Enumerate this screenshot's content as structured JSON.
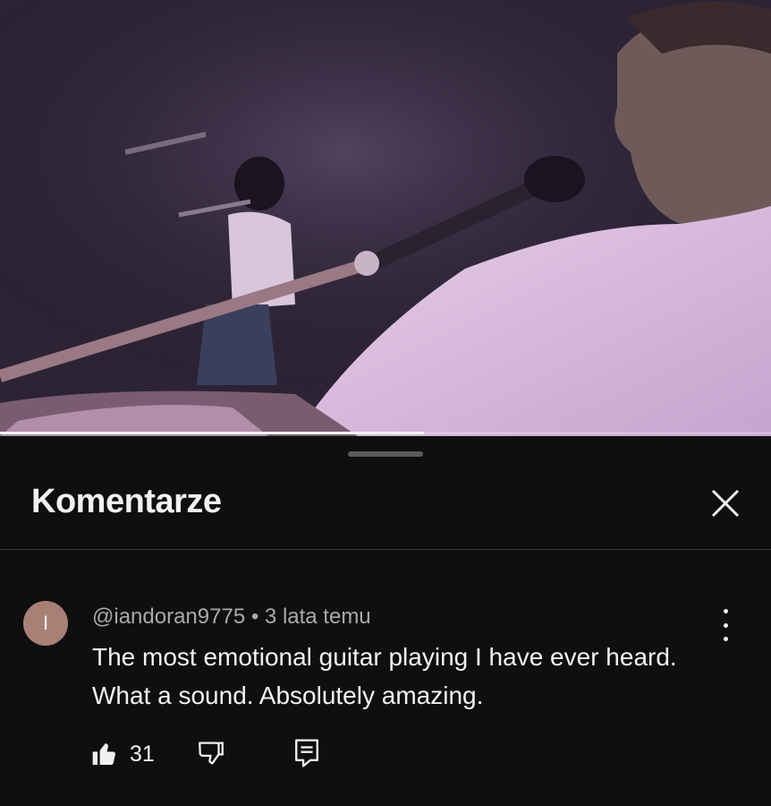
{
  "video": {
    "progress_fraction": 0.55
  },
  "panel": {
    "title": "Komentarze"
  },
  "comment": {
    "avatar_letter": "I",
    "avatar_color": "#a88076",
    "author": "@iandoran9775",
    "separator": "•",
    "time": "3 lata temu",
    "text": "The most emotional guitar playing I have ever heard. What a sound. Absolutely amazing.",
    "likes": "31"
  },
  "icons": {
    "close": "close-icon",
    "more": "more-vert-icon",
    "like": "thumb-up-icon",
    "dislike": "thumb-down-icon",
    "reply": "reply-icon"
  }
}
